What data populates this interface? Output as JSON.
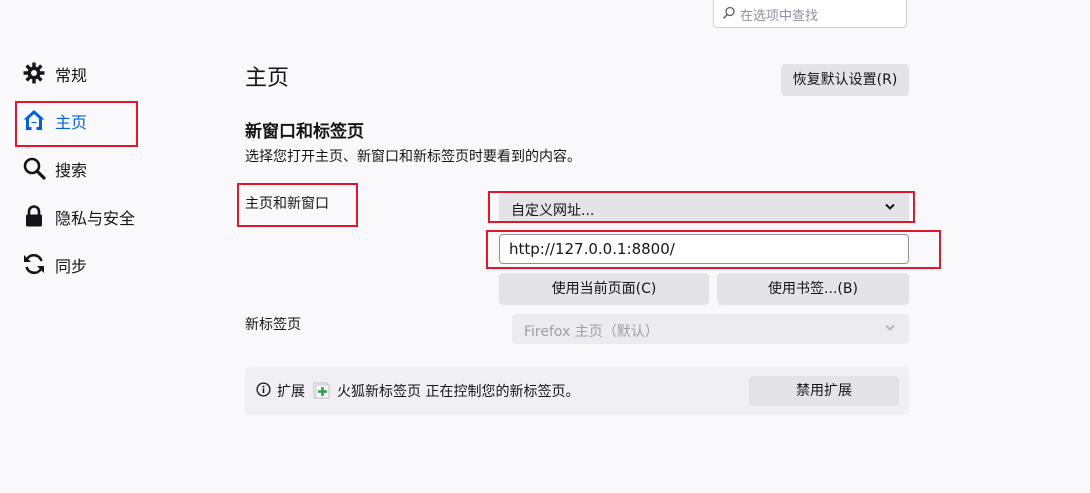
{
  "search": {
    "placeholder": "在选项中查找"
  },
  "sidebar": {
    "items": [
      {
        "label": "常规",
        "icon": "gear-icon"
      },
      {
        "label": "主页",
        "icon": "home-icon",
        "active": true
      },
      {
        "label": "搜索",
        "icon": "search-icon"
      },
      {
        "label": "隐私与安全",
        "icon": "lock-icon"
      },
      {
        "label": "同步",
        "icon": "sync-icon"
      }
    ]
  },
  "main": {
    "title": "主页",
    "restore_button": "恢复默认设置(R)",
    "section_title": "新窗口和标签页",
    "section_desc": "选择您打开主页、新窗口和新标签页时要看到的内容。",
    "homepage_label": "主页和新窗口",
    "homepage_select": "自定义网址...",
    "homepage_url": "http://127.0.0.1:8800/",
    "use_current_button": "使用当前页面(C)",
    "use_bookmark_button": "使用书签...(B)",
    "newtab_label": "新标签页",
    "newtab_select": "Firefox 主页（默认）",
    "notice_prefix": "扩展",
    "notice_text": "火狐新标签页 正在控制您的新标签页。",
    "disable_extension_button": "禁用扩展"
  },
  "colors": {
    "accent": "#0061e0",
    "highlight": "#e5152b",
    "background": "#f9f9fb"
  }
}
